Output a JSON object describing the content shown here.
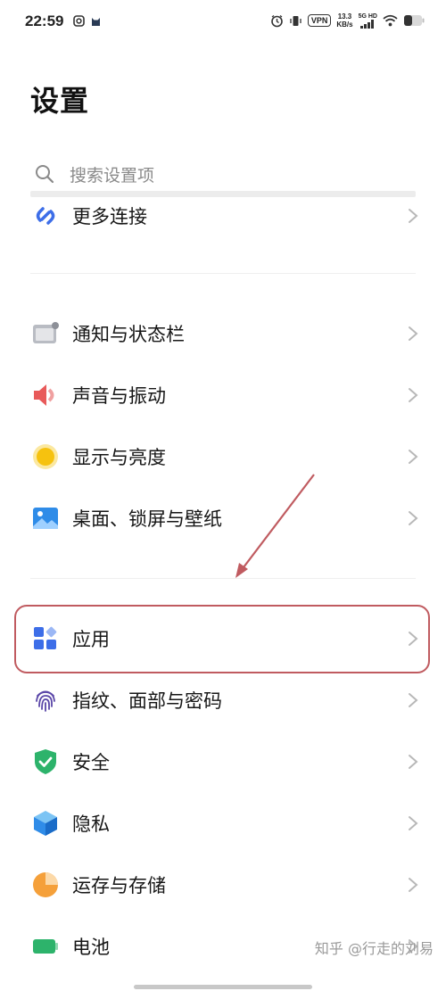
{
  "status_bar": {
    "time": "22:59",
    "vpn": "VPN",
    "net_speed_value": "13.3",
    "net_speed_unit": "KB/s",
    "signal_label": "5G HD",
    "icons": [
      "instagram-icon",
      "cat-icon",
      "alarm-icon",
      "vibrate-icon",
      "signal-icon",
      "wifi-icon",
      "battery-icon"
    ]
  },
  "header": {
    "title": "设置"
  },
  "search": {
    "placeholder": "搜索设置项"
  },
  "settings": {
    "more_connections": "更多连接",
    "notifications": "通知与状态栏",
    "sound": "声音与振动",
    "display": "显示与亮度",
    "wallpaper": "桌面、锁屏与壁纸",
    "apps": "应用",
    "biometrics": "指纹、面部与密码",
    "security": "安全",
    "privacy": "隐私",
    "storage": "运存与存储",
    "battery": "电池"
  },
  "colors": {
    "highlight": "#c05b60",
    "blue_icon": "#3d6ee8",
    "red_icon": "#e85a5a",
    "yellow_icon": "#f6c20f",
    "green_icon": "#2db36b",
    "orange_icon": "#f5a03a"
  },
  "watermark": "知乎 @行走的刘易"
}
